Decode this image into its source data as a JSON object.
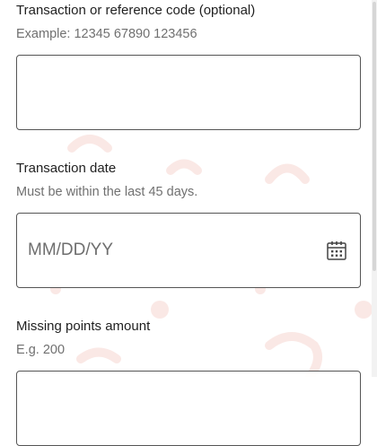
{
  "form": {
    "transaction_code": {
      "label": "Transaction or reference code (optional)",
      "hint": "Example: 12345 67890 123456",
      "value": "",
      "placeholder": ""
    },
    "transaction_date": {
      "label": "Transaction date",
      "hint": "Must be within the last 45 days.",
      "value": "",
      "placeholder": "MM/DD/YY",
      "icon": "calendar-icon"
    },
    "missing_points": {
      "label": "Missing points amount",
      "hint": "E.g. 200",
      "value": "",
      "placeholder": ""
    }
  },
  "theme": {
    "accent": "#e8402a",
    "border": "#555555",
    "hint_text": "#707070"
  }
}
